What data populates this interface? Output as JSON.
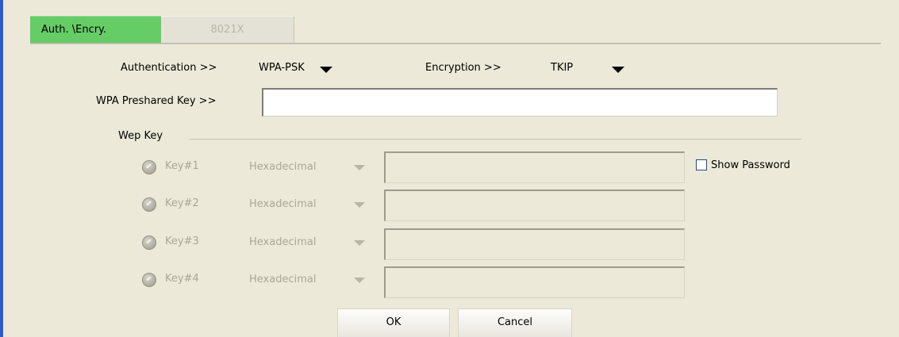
{
  "tabs": [
    {
      "label": "Auth. \\Encry.",
      "active": true
    },
    {
      "label": "8021X",
      "active": false
    }
  ],
  "authentication": {
    "label": "Authentication >>",
    "value": "WPA-PSK"
  },
  "encryption": {
    "label": "Encryption >>",
    "value": "TKIP"
  },
  "psk": {
    "label": "WPA Preshared Key >>",
    "value": ""
  },
  "wep": {
    "group_label": "Wep Key",
    "keys": [
      {
        "label": "Key#1",
        "format": "Hexadecimal",
        "value": ""
      },
      {
        "label": "Key#2",
        "format": "Hexadecimal",
        "value": ""
      },
      {
        "label": "Key#3",
        "format": "Hexadecimal",
        "value": ""
      },
      {
        "label": "Key#4",
        "format": "Hexadecimal",
        "value": ""
      }
    ]
  },
  "show_password": {
    "label": "Show Password",
    "checked": false
  },
  "buttons": {
    "ok": "OK",
    "cancel": "Cancel"
  },
  "colors": {
    "accent_bar": "#2a5cc9",
    "active_tab": "#66cc66",
    "background": "#ece9d8"
  },
  "icons": {
    "dropdown": "triangle-down-icon",
    "key_radio": "radio-icon"
  }
}
